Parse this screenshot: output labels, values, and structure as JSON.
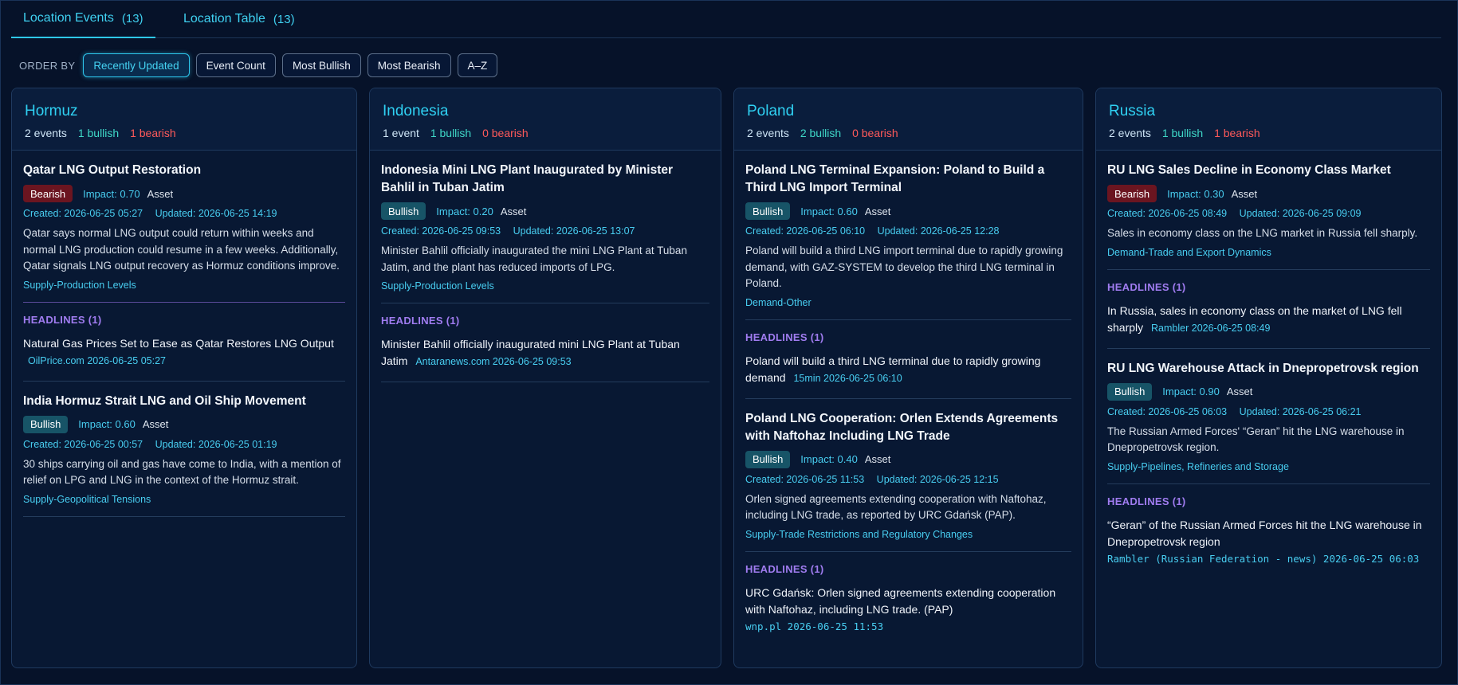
{
  "tabs": [
    {
      "label": "Location Events",
      "count": "(13)"
    },
    {
      "label": "Location Table",
      "count": "(13)"
    }
  ],
  "order": {
    "label": "ORDER BY",
    "options": [
      "Recently Updated",
      "Event Count",
      "Most Bullish",
      "Most Bearish",
      "A–Z"
    ],
    "selected": "Recently Updated"
  },
  "columns": {
    "hormuz": {
      "title": "Hormuz",
      "events_count": "2 events",
      "bullish": "1 bullish",
      "bearish": "1 bearish",
      "events": [
        {
          "title": "Qatar LNG Output Restoration",
          "sentiment": "Bearish",
          "impact": "Impact: 0.70",
          "asset": "Asset",
          "created": "Created: 2026-06-25 05:27",
          "updated": "Updated: 2026-06-25 14:19",
          "summary": "Qatar says normal LNG output could return within weeks and normal LNG production could resume in a few weeks. Additionally, Qatar signals LNG output recovery as Hormuz conditions improve.",
          "category": "Supply-Production Levels",
          "headlines_label": "HEADLINES (1)",
          "headline": "Natural Gas Prices Set to Ease as Qatar Restores LNG Output",
          "headline_source": "OilPrice.com 2026-06-25 05:27"
        },
        {
          "title": "India Hormuz Strait LNG and Oil Ship Movement",
          "sentiment": "Bullish",
          "impact": "Impact: 0.60",
          "asset": "Asset",
          "created": "Created: 2026-06-25 00:57",
          "updated": "Updated: 2026-06-25 01:19",
          "summary": "30 ships carrying oil and gas have come to India, with a mention of relief on LPG and LNG in the context of the Hormuz strait.",
          "category": "Supply-Geopolitical Tensions"
        }
      ]
    },
    "indonesia": {
      "title": "Indonesia",
      "events_count": "1 event",
      "bullish": "1 bullish",
      "bearish": "0 bearish",
      "events": [
        {
          "title": "Indonesia Mini LNG Plant Inaugurated by Minister Bahlil in Tuban Jatim",
          "sentiment": "Bullish",
          "impact": "Impact: 0.20",
          "asset": "Asset",
          "created": "Created: 2026-06-25 09:53",
          "updated": "Updated: 2026-06-25 13:07",
          "summary": "Minister Bahlil officially inaugurated the mini LNG Plant at Tuban Jatim, and the plant has reduced imports of LPG.",
          "category": "Supply-Production Levels",
          "headlines_label": "HEADLINES (1)",
          "headline": "Minister Bahlil officially inaugurated mini LNG Plant at Tuban Jatim",
          "headline_source": "Antaranews.com 2026-06-25 09:53"
        }
      ]
    },
    "poland": {
      "title": "Poland",
      "events_count": "2 events",
      "bullish": "2 bullish",
      "bearish": "0 bearish",
      "events": [
        {
          "title": "Poland LNG Terminal Expansion: Poland to Build a Third LNG Import Terminal",
          "sentiment": "Bullish",
          "impact": "Impact: 0.60",
          "asset": "Asset",
          "created": "Created: 2026-06-25 06:10",
          "updated": "Updated: 2026-06-25 12:28",
          "summary": "Poland will build a third LNG import terminal due to rapidly growing demand, with GAZ-SYSTEM to develop the third LNG terminal in Poland.",
          "category": "Demand-Other",
          "headlines_label": "HEADLINES (1)",
          "headline": "Poland will build a third LNG terminal due to rapidly growing demand",
          "headline_source": "15min 2026-06-25 06:10"
        },
        {
          "title": "Poland LNG Cooperation: Orlen Extends Agreements with Naftohaz Including LNG Trade",
          "sentiment": "Bullish",
          "impact": "Impact: 0.40",
          "asset": "Asset",
          "created": "Created: 2026-06-25 11:53",
          "updated": "Updated: 2026-06-25 12:15",
          "summary": "Orlen signed agreements extending cooperation with Naftohaz, including LNG trade, as reported by URC Gdańsk (PAP).",
          "category": "Supply-Trade Restrictions and Regulatory Changes",
          "headlines_label": "HEADLINES (1)",
          "headline": "URC Gdańsk: Orlen signed agreements extending cooperation with Naftohaz, including LNG trade. (PAP)",
          "headline_source": "wnp.pl 2026-06-25 11:53"
        }
      ]
    },
    "russia": {
      "title": "Russia",
      "events_count": "2 events",
      "bullish": "1 bullish",
      "bearish": "1 bearish",
      "events": [
        {
          "title": "RU LNG Sales Decline in Economy Class Market",
          "sentiment": "Bearish",
          "impact": "Impact: 0.30",
          "asset": "Asset",
          "created": "Created: 2026-06-25 08:49",
          "updated": "Updated: 2026-06-25 09:09",
          "summary": "Sales in economy class on the LNG market in Russia fell sharply.",
          "category": "Demand-Trade and Export Dynamics",
          "headlines_label": "HEADLINES (1)",
          "headline": "In Russia, sales in economy class on the market of LNG fell sharply",
          "headline_source": "Rambler 2026-06-25 08:49"
        },
        {
          "title": "RU LNG Warehouse Attack in Dnepropetrovsk region",
          "sentiment": "Bullish",
          "impact": "Impact: 0.90",
          "asset": "Asset",
          "created": "Created: 2026-06-25 06:03",
          "updated": "Updated: 2026-06-25 06:21",
          "summary": "The Russian Armed Forces' “Geran” hit the LNG warehouse in Dnepropetrovsk region.",
          "category": "Supply-Pipelines, Refineries and Storage",
          "headlines_label": "HEADLINES (1)",
          "headline": "“Geran” of the Russian Armed Forces hit the LNG warehouse in Dnepropetrovsk region",
          "headline_source": "Rambler (Russian Federation - news) 2026-06-25 06:03"
        }
      ]
    }
  }
}
